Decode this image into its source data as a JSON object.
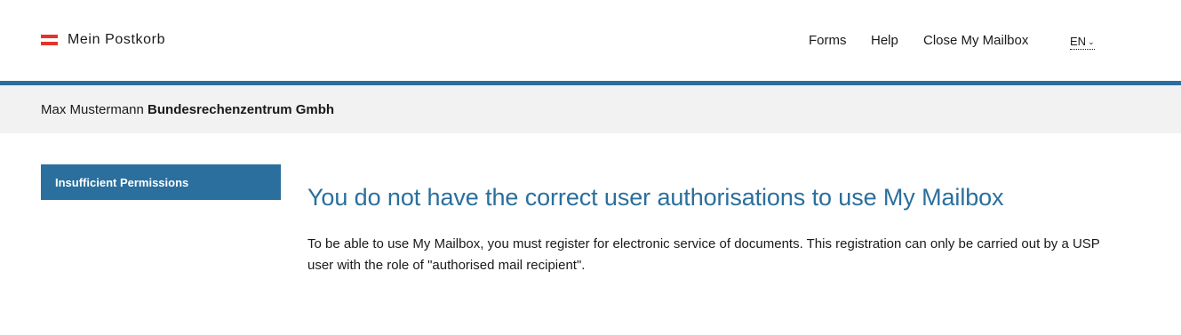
{
  "header": {
    "brand": "Mein Postkorb",
    "nav": [
      "Forms",
      "Help",
      "Close My Mailbox"
    ],
    "language": "EN"
  },
  "userbar": {
    "person": "Max Mustermann",
    "organisation": "Bundesrechenzentrum Gmbh"
  },
  "sidebar": {
    "active_item": "Insufficient Permissions"
  },
  "main": {
    "title": "You do not have the correct user authorisations to use My Mailbox",
    "body": "To be able to use My Mailbox, you must register for electronic service of documents. This registration can only be carried out by a USP user with the role of \"authorised mail recipient\"."
  },
  "colors": {
    "accent": "#2a6f9d",
    "flag_red": "#e4342b",
    "userbar_bg": "#f2f2f2"
  },
  "icons": {
    "brand": "austria-flag-icon",
    "language_toggle": "chevron-down-icon"
  }
}
